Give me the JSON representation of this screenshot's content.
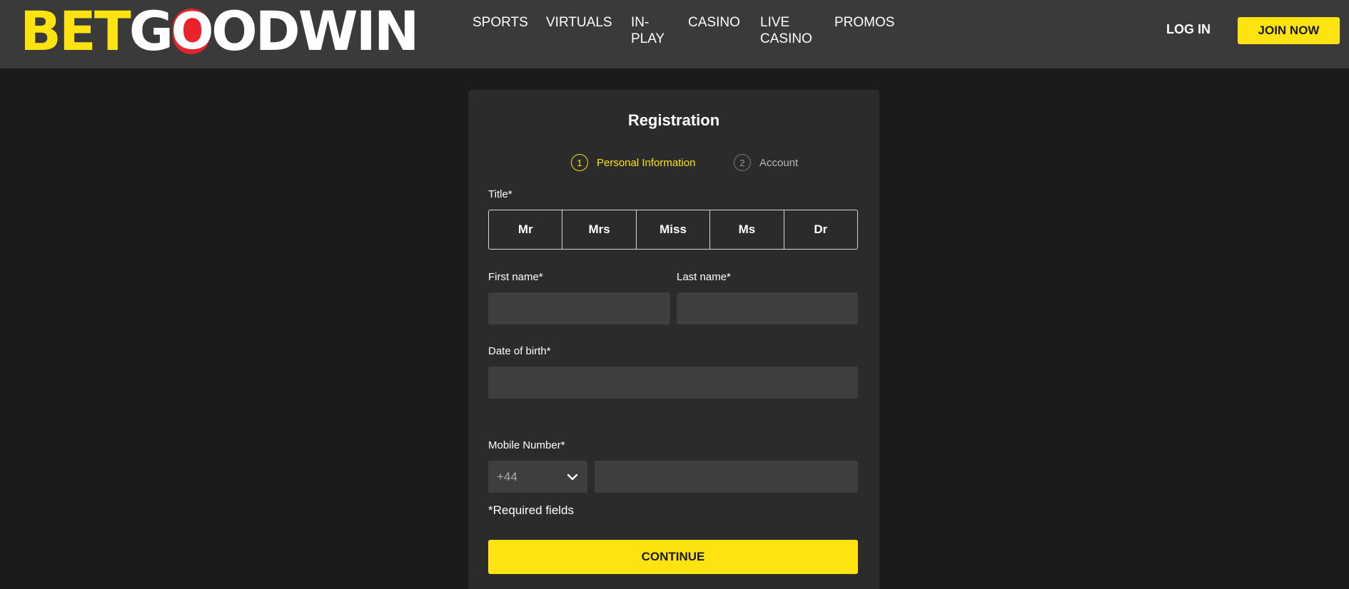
{
  "header": {
    "logo": {
      "part1": "BET",
      "part2": "G",
      "part3": "O",
      "part4": "ODWIN"
    },
    "nav": [
      {
        "label": "SPORTS"
      },
      {
        "label": "VIRTUALS"
      },
      {
        "label": "IN-\nPLAY"
      },
      {
        "label": "CASINO"
      },
      {
        "label": "LIVE\nCASINO"
      },
      {
        "label": "PROMOS"
      }
    ],
    "login_label": "LOG IN",
    "join_label": "JOIN NOW"
  },
  "form": {
    "title": "Registration",
    "steps": [
      {
        "number": "1",
        "label": "Personal Information",
        "active": true
      },
      {
        "number": "2",
        "label": "Account",
        "active": false
      }
    ],
    "title_label": "Title*",
    "title_options": [
      "Mr",
      "Mrs",
      "Miss",
      "Ms",
      "Dr"
    ],
    "first_name_label": "First name*",
    "first_name_value": "",
    "last_name_label": "Last name*",
    "last_name_value": "",
    "dob_label": "Date of birth*",
    "dob_value": "",
    "mobile_label": "Mobile Number*",
    "country_code": "+44",
    "mobile_value": "",
    "required_note": "*Required fields",
    "continue_label": "CONTINUE"
  },
  "colors": {
    "accent": "#fde30f",
    "logo_red": "#e8232b",
    "header_bg": "#3a3a3a",
    "page_bg": "#1b1b1b",
    "card_bg": "#2b2b2b",
    "input_bg": "#3e3e3e"
  },
  "icons": {
    "country_select": "chevron-down-icon"
  }
}
